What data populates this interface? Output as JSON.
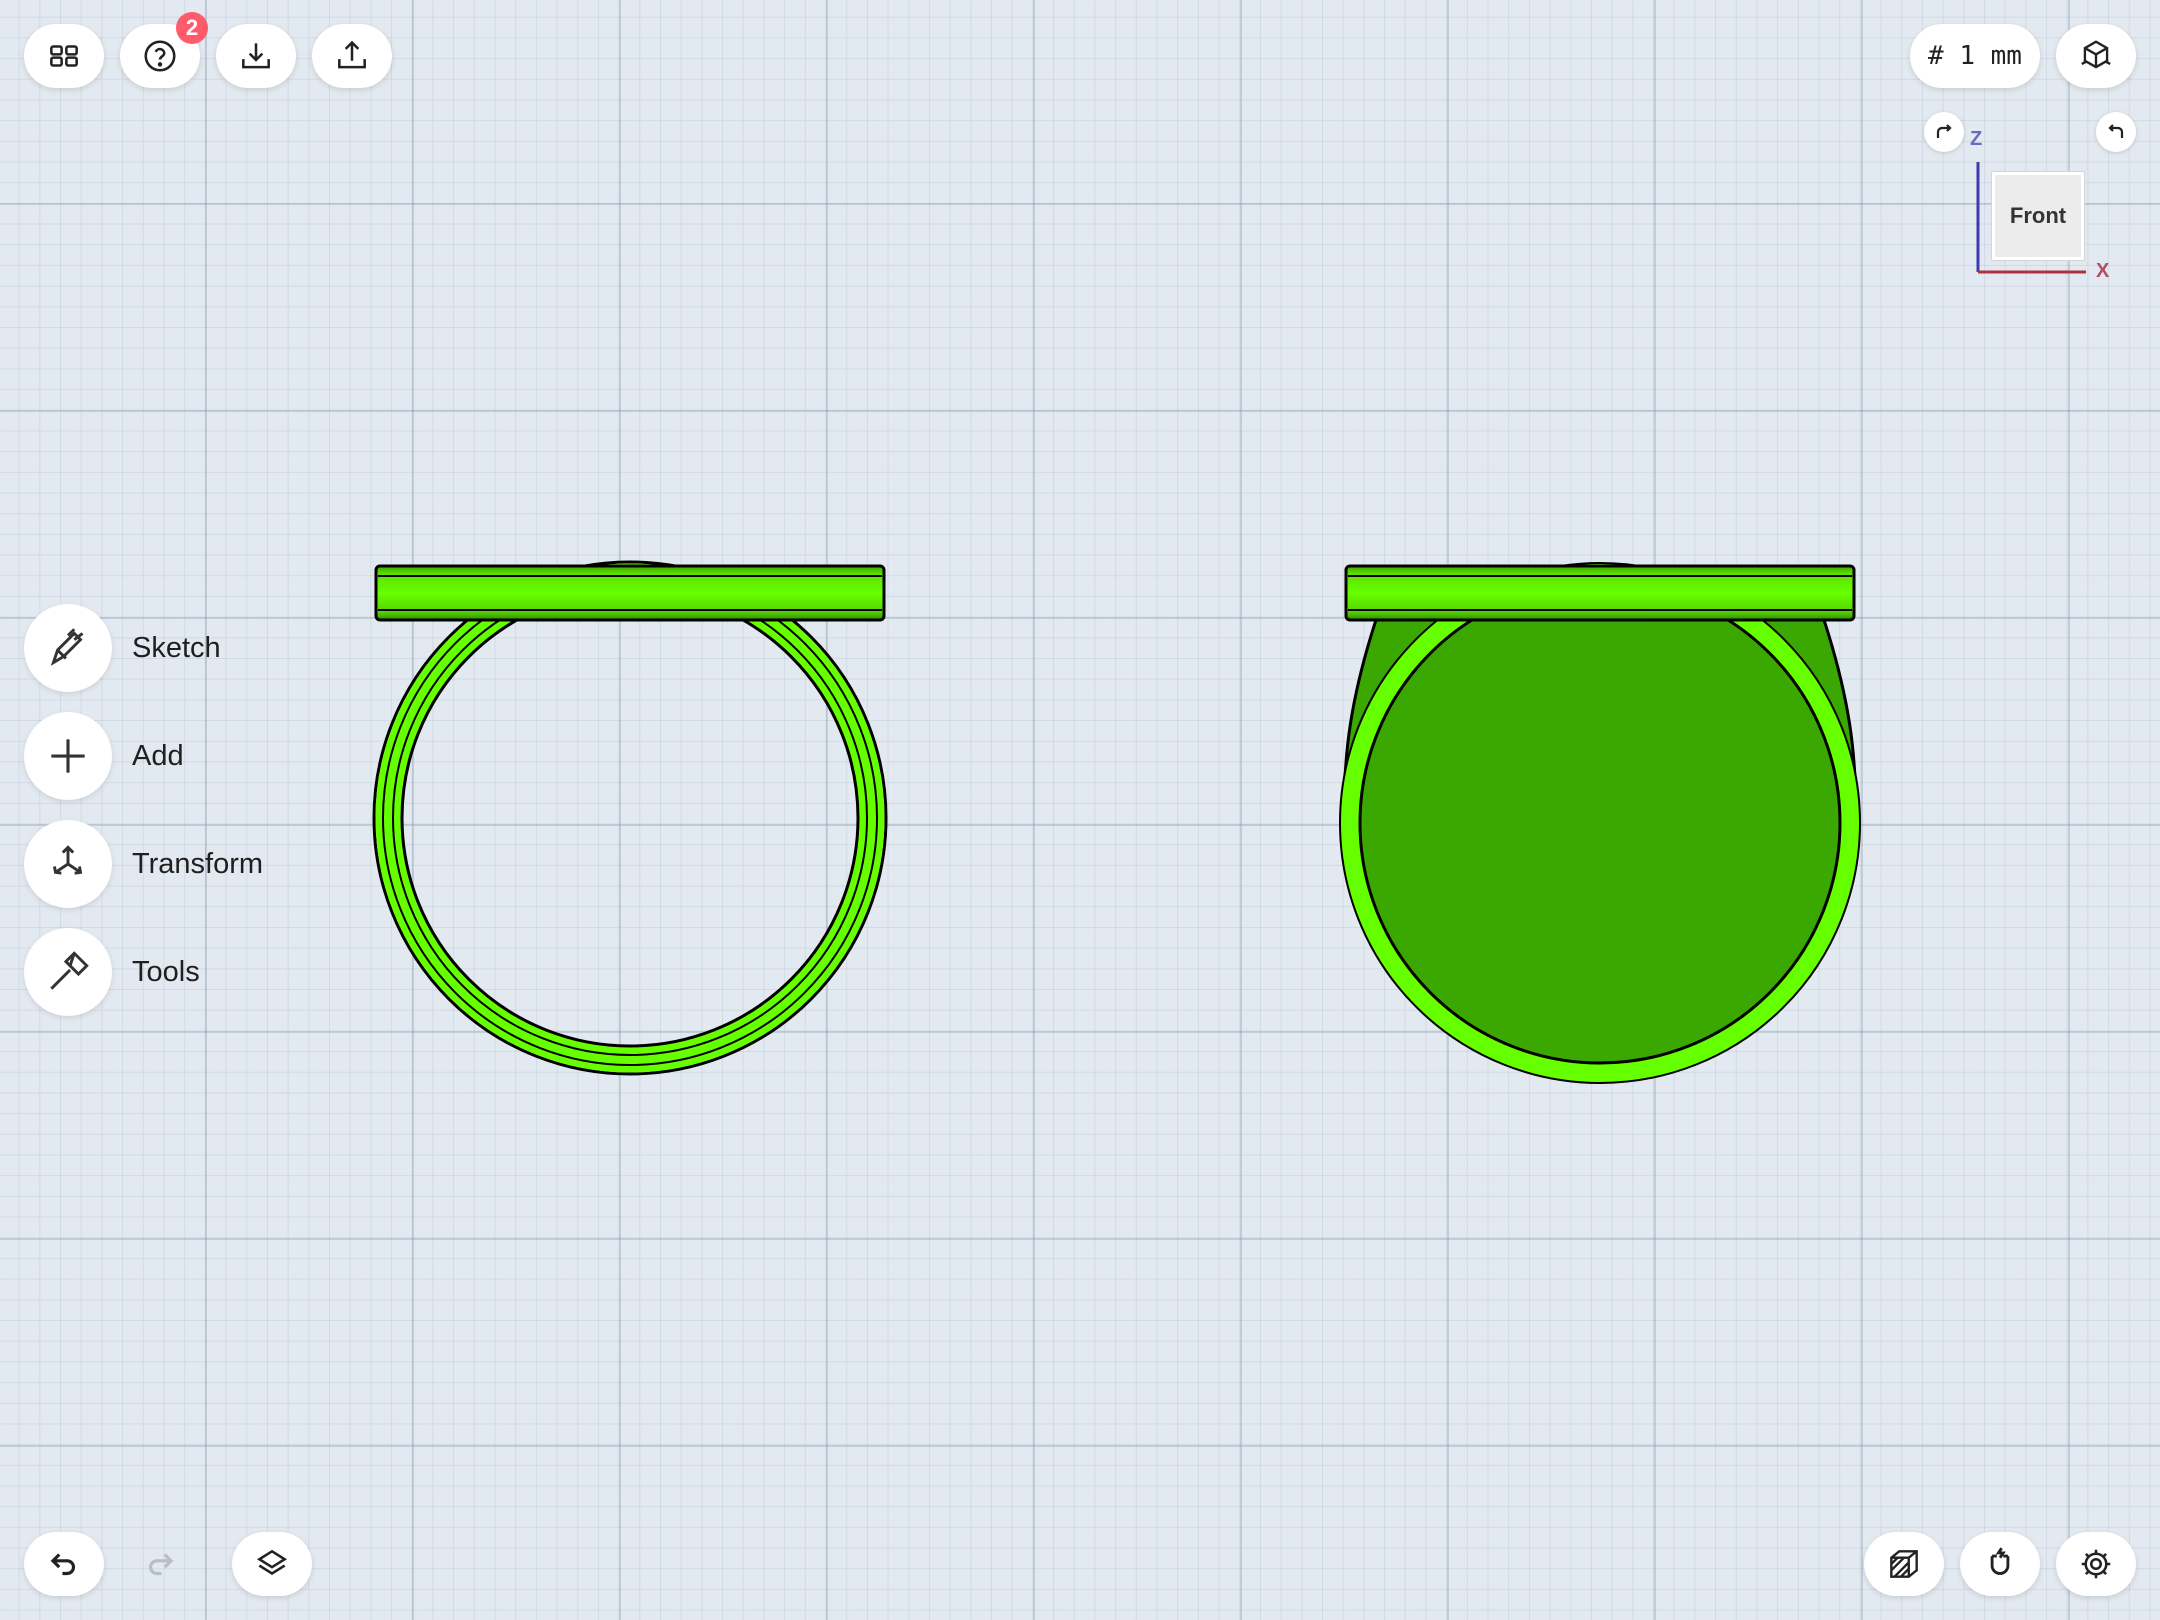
{
  "toolbar": {
    "notification_count": "2",
    "grid_size_label": "# 1 mm"
  },
  "side_menu": {
    "items": [
      {
        "label": "Sketch",
        "icon": "pencil-icon"
      },
      {
        "label": "Add",
        "icon": "plus-icon"
      },
      {
        "label": "Transform",
        "icon": "transform-arrows-icon"
      },
      {
        "label": "Tools",
        "icon": "hammer-icon"
      }
    ]
  },
  "view_cube": {
    "face_label": "Front",
    "axis_z": "Z",
    "axis_x": "X"
  },
  "colors": {
    "model_green": "#66ff00",
    "model_dark_green": "#3aa800",
    "badge": "#ff5a6a",
    "axis_z": "#3c3cb0",
    "axis_x": "#b03040"
  }
}
